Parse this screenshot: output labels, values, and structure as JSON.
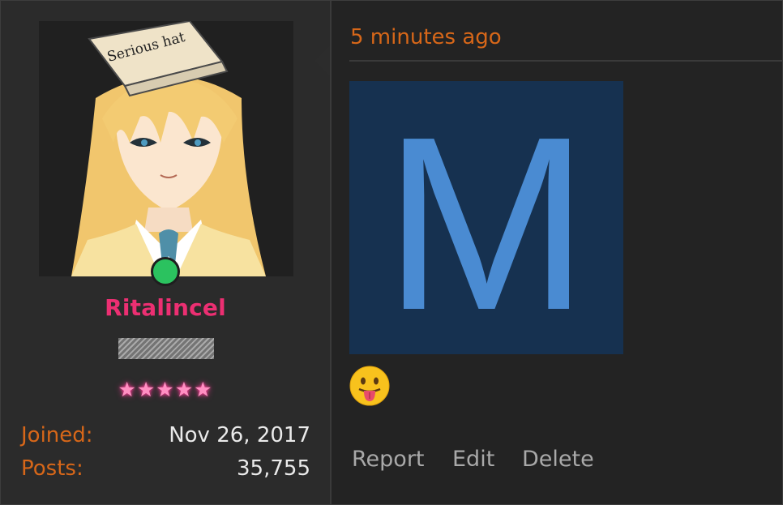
{
  "post": {
    "timestamp": "5 minutes ago",
    "content_image_letter": "M",
    "emoji": "tongue-out-emoji",
    "actions": [
      "Report",
      "Edit",
      "Delete"
    ]
  },
  "user": {
    "avatar_hat_text": "Serious hat",
    "username": "Ritalincel",
    "online": true,
    "stars": "★★★★★",
    "stats": [
      {
        "label": "Joined:",
        "value": "Nov 26, 2017"
      },
      {
        "label": "Posts:",
        "value": "35,755"
      }
    ]
  },
  "colors": {
    "username": "#ec2f72",
    "label": "#d76719",
    "online": "#2bc25f",
    "image_bg": "#163150",
    "image_letter": "#4a8bd2"
  }
}
